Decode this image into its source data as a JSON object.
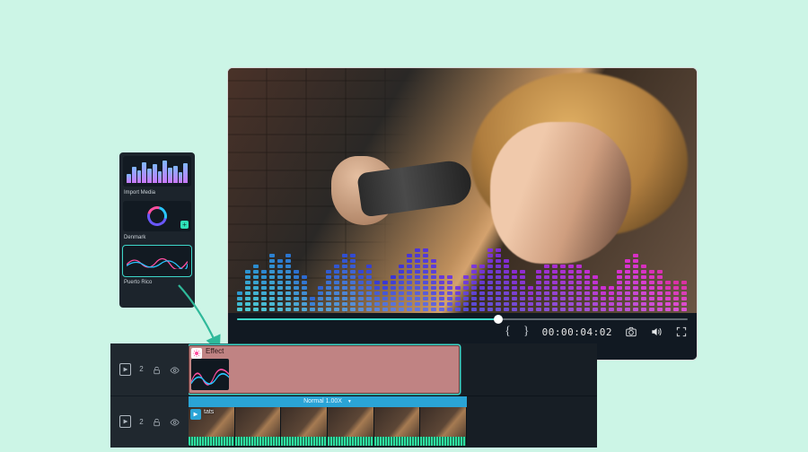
{
  "preview": {
    "timecode": "00:00:04:02",
    "progress_pct": 58
  },
  "media_panel": {
    "items": [
      {
        "label": "Import Media",
        "kind": "equalizer"
      },
      {
        "label": "Denmark",
        "kind": "ring"
      },
      {
        "label": "Puerto Rico",
        "kind": "wave",
        "selected": true
      }
    ]
  },
  "timeline": {
    "tracks": [
      {
        "number": "2",
        "kind": "effect"
      },
      {
        "number": "2",
        "kind": "video"
      }
    ],
    "effect_clip": {
      "label": "Effect"
    },
    "video_clip": {
      "label": "tats",
      "speed_label": "Normal 1.00X"
    }
  },
  "icons": {
    "brace_open": "{",
    "brace_close": "}",
    "add": "+"
  }
}
